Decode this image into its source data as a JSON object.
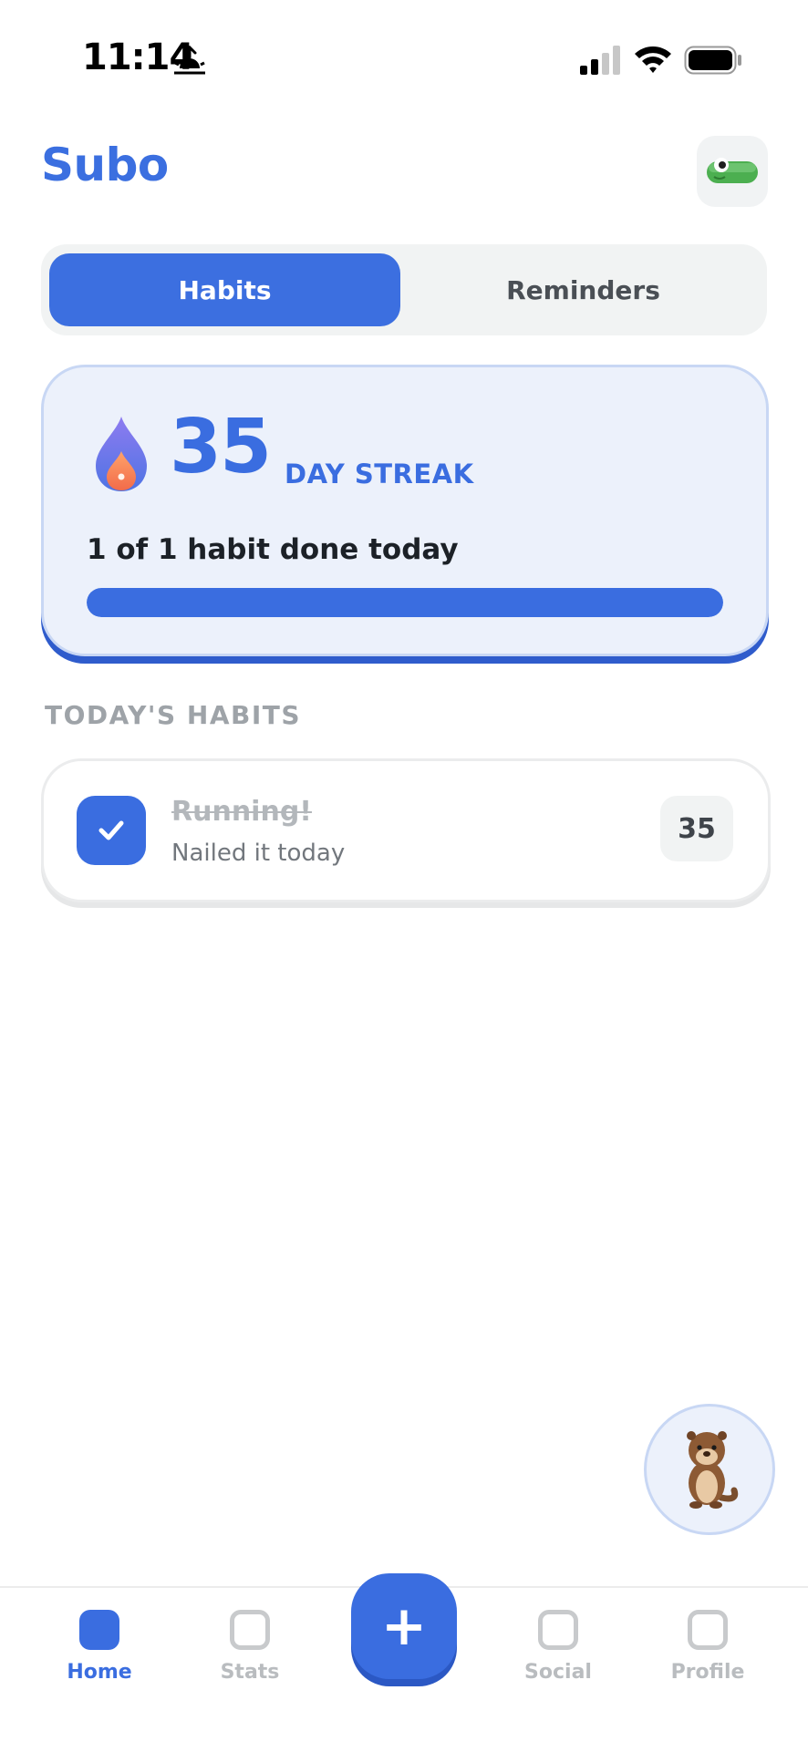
{
  "status_bar": {
    "time": "11:14",
    "icons": [
      "sunrise-icon",
      "signal-icon",
      "wifi-icon",
      "battery-icon"
    ]
  },
  "header": {
    "title": "Subo",
    "toggle_icon": "mascot-toggle-icon"
  },
  "tabs": [
    {
      "label": "Habits",
      "active": true
    },
    {
      "label": "Reminders",
      "active": false
    }
  ],
  "streak": {
    "icon": "flame-icon",
    "count": "35",
    "label": "DAY STREAK",
    "progress_text": "1 of 1 habit done today",
    "progress_fraction": 1.0
  },
  "section": {
    "heading": "TODAY'S HABITS"
  },
  "habits": [
    {
      "name": "Running!",
      "status": "Nailed it today",
      "completed": true,
      "count": "35"
    }
  ],
  "fab": {
    "icon": "otter-icon"
  },
  "bottom_nav": {
    "items": [
      {
        "label": "Home",
        "active": true
      },
      {
        "label": "Stats",
        "active": false
      },
      {
        "label": "Social",
        "active": false
      },
      {
        "label": "Profile",
        "active": false
      }
    ],
    "add_label": "+"
  },
  "colors": {
    "brand": "#3a6de0",
    "card_bg": "#ecf1fb",
    "muted": "#b9bcbf"
  }
}
